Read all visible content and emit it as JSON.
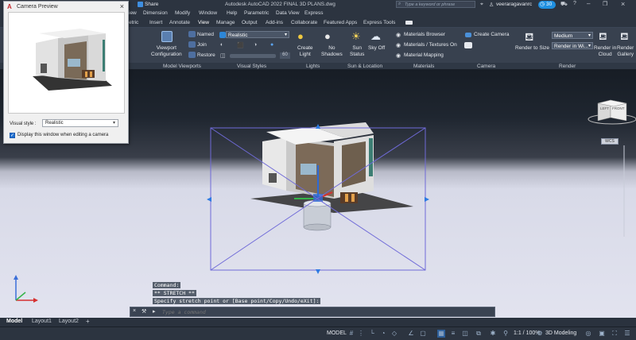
{
  "titlebar": {
    "share_label": "Share",
    "window_title": "Autodesk AutoCAD 2022    FINAL 3D PLANS.dwg",
    "search_placeholder": "Type a keyword or phrase",
    "user_name": "veeraragavanrc",
    "timer": "30"
  },
  "menubar": {
    "items": [
      "iew",
      "Dimension",
      "Modify",
      "Window",
      "Help",
      "Parametric",
      "Data View",
      "Express"
    ]
  },
  "tabs": {
    "items": [
      "etric",
      "Insert",
      "Annotate",
      "View",
      "Manage",
      "Output",
      "Add-ins",
      "Collaborate",
      "Featured Apps",
      "Express Tools"
    ]
  },
  "ribbon": {
    "viewport_config": "Viewport\nConfiguration",
    "named": "Named",
    "join": "Join",
    "restore": "Restore",
    "visual_style": "Realistic",
    "opacity_value": "60",
    "create_light": "Create\nLight",
    "no_shadows": "No\nShadows",
    "sun_status": "Sun\nStatus",
    "sky_off": "Sky Off",
    "materials_browser": "Materials Browser",
    "materials_textures": "Materials / Textures On",
    "material_mapping": "Material Mapping",
    "create_camera": "Create Camera",
    "render_to_size": "Render to Size",
    "render_quality": "Medium",
    "render_in": "Render in Wi...",
    "render_in_cloud": "Render in\nCloud",
    "render_gallery": "Render\nGallery"
  },
  "panels": {
    "model_viewports": "Model Viewports",
    "visual_styles": "Visual Styles",
    "lights": "Lights",
    "sun_location": "Sun & Location",
    "materials": "Materials",
    "camera": "Camera",
    "render": "Render"
  },
  "camera_preview": {
    "title": "Camera Preview",
    "visual_style_label": "Visual style :",
    "visual_style_value": "Realistic",
    "display_checkbox_label": "Display this window when editing a camera",
    "display_checked": true
  },
  "viewcube": {
    "left": "LEFT",
    "front": "FRONT",
    "wcs": "WCS"
  },
  "command": {
    "line1": "Command:",
    "line2": "** STRETCH **",
    "line3": "Specify stretch point or [Base point/Copy/Undo/eXit]:",
    "placeholder": "Type a command"
  },
  "layout_tabs": {
    "model": "Model",
    "layout1": "Layout1",
    "layout2": "Layout2",
    "add": "+"
  },
  "statusbar": {
    "model": "MODEL",
    "scale": "1:1 / 100%",
    "workspace": "3D Modeling"
  }
}
